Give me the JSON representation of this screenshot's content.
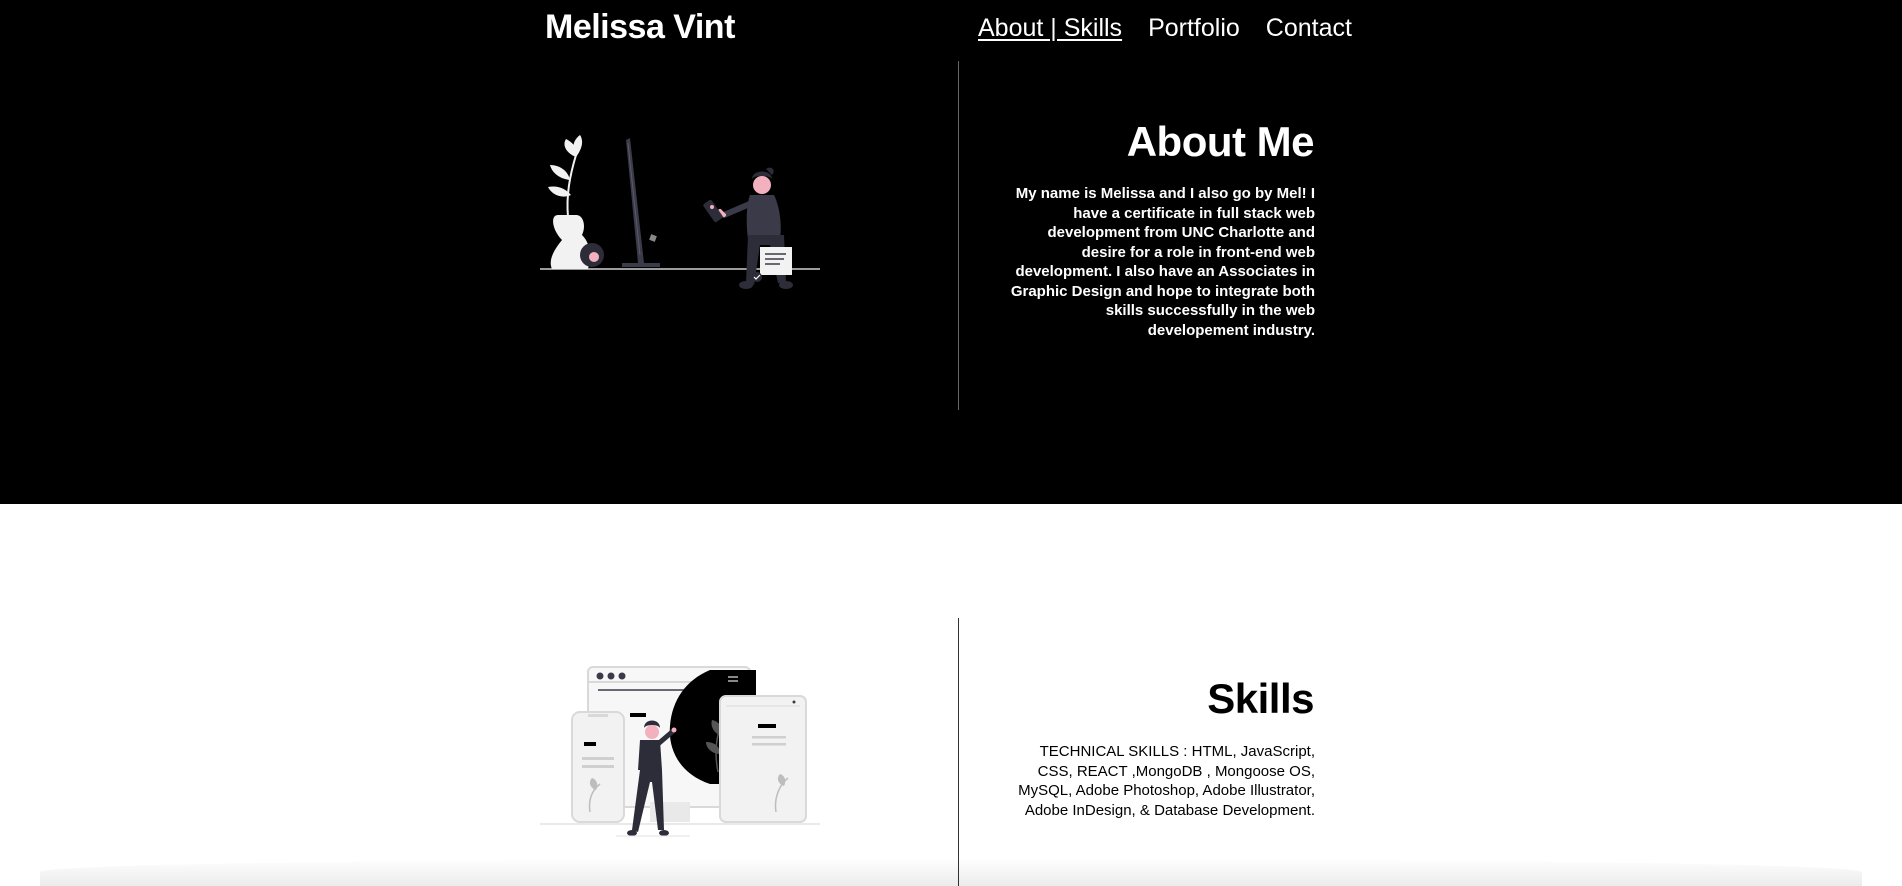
{
  "brand": "Melissa Vint",
  "nav": [
    {
      "label": "About | Skills",
      "active": true
    },
    {
      "label": "Portfolio",
      "active": false
    },
    {
      "label": "Contact",
      "active": false
    }
  ],
  "about": {
    "title": "About Me",
    "text": "My name is Melissa and I also go by Mel! I have a certificate in full stack web development from UNC Charlotte and desire for a role in front-end web development. I also have an Associates in Graphic Design and hope to integrate both skills successfully in the web developement industry."
  },
  "skills": {
    "title": "Skills",
    "text": "TECHNICAL SKILLS : HTML, JavaScript, CSS, REACT ,MongoDB , Mongoose OS, MySQL, Adobe Photoshop, Adobe Illustrator, Adobe InDesign, & Database Development."
  },
  "colors": {
    "dark_bg": "#000000",
    "light_bg": "#ffffff",
    "accent": "#f3b1c0"
  }
}
